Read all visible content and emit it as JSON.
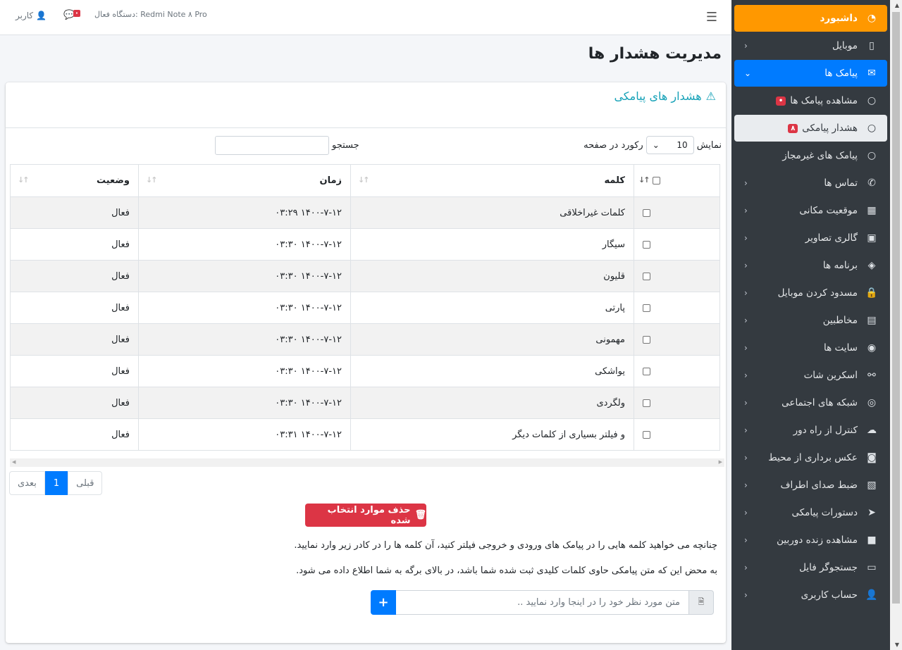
{
  "topbar": {
    "device_text": "دستگاه فعال: Redmi Note ۸ Pro",
    "user_label": "کاربر",
    "chat_badge": "•"
  },
  "page_title": "مدیریت هشدار ها",
  "card": {
    "title": "هشدار های پیامکی"
  },
  "controls": {
    "show_label": "نمایش",
    "length_value": "10",
    "records_label": "رکورد در صفحه",
    "search_label": "جستجو"
  },
  "table": {
    "headers": {
      "word": "کلمه",
      "time": "زمان",
      "status": "وضعیت"
    },
    "rows": [
      {
        "word": "کلمات غیراخلاقی",
        "time": "۱۴۰۰-۷-۱۲ ۰۳:۲۹",
        "status": "فعال"
      },
      {
        "word": "سیگار",
        "time": "۱۴۰۰-۷-۱۲ ۰۳:۳۰",
        "status": "فعال"
      },
      {
        "word": "قلیون",
        "time": "۱۴۰۰-۷-۱۲ ۰۳:۳۰",
        "status": "فعال"
      },
      {
        "word": "پارتی",
        "time": "۱۴۰۰-۷-۱۲ ۰۳:۳۰",
        "status": "فعال"
      },
      {
        "word": "مهمونی",
        "time": "۱۴۰۰-۷-۱۲ ۰۳:۳۰",
        "status": "فعال"
      },
      {
        "word": "یواشکی",
        "time": "۱۴۰۰-۷-۱۲ ۰۳:۳۰",
        "status": "فعال"
      },
      {
        "word": "ولگردی",
        "time": "۱۴۰۰-۷-۱۲ ۰۳:۳۰",
        "status": "فعال"
      },
      {
        "word": "و فیلتر بسیاری از کلمات دیگر",
        "time": "۱۴۰۰-۷-۱۲ ۰۳:۳۱",
        "status": "فعال"
      }
    ]
  },
  "pager": {
    "prev": "قبلی",
    "current": "1",
    "next": "بعدی"
  },
  "delete_button": "حذف موارد انتخاب شده",
  "info": {
    "line1": "چنانچه می خواهید کلمه هایی را در پیامک های ورودی و خروجی فیلتر کنید، آن کلمه ها را در کادر زیر وارد نمایید.",
    "line2": "به محض این که متن پیامکی حاوی کلمات کلیدی ثبت شده شما باشد، در بالای برگه به شما اطلاع داده می شود."
  },
  "add_input": {
    "placeholder": "متن مورد نظر خود را در اینجا وارد نمایید ..",
    "add_label": "+"
  },
  "sidebar": {
    "items": [
      {
        "label": "داشبورد",
        "icon": "dashboard-icon"
      },
      {
        "label": "موبایل",
        "icon": "mobile-icon"
      },
      {
        "label": "پیامک ها",
        "icon": "envelope-icon"
      },
      {
        "label": "مشاهده پیامک ها",
        "icon": "circle-icon",
        "badge": "•"
      },
      {
        "label": "هشدار پیامکی",
        "icon": "circle-icon",
        "badge": "۸"
      },
      {
        "label": "پیامک های غیرمجاز",
        "icon": "circle-icon"
      },
      {
        "label": "تماس ها",
        "icon": "phone-icon"
      },
      {
        "label": "موقعیت مکانی",
        "icon": "map-icon"
      },
      {
        "label": "گالری تصاویر",
        "icon": "image-icon"
      },
      {
        "label": "برنامه ها",
        "icon": "gamepad-icon"
      },
      {
        "label": "مسدود کردن موبایل",
        "icon": "lock-icon"
      },
      {
        "label": "مخاطبین",
        "icon": "book-icon"
      },
      {
        "label": "سایت ها",
        "icon": "chrome-icon"
      },
      {
        "label": "اسکرین شات",
        "icon": "binoculars-icon"
      },
      {
        "label": "شبکه های اجتماعی",
        "icon": "eye-icon"
      },
      {
        "label": "کنترل از راه دور",
        "icon": "cloud-icon"
      },
      {
        "label": "عکس برداری از محیط",
        "icon": "camera-icon"
      },
      {
        "label": "ضبط صدای اطراف",
        "icon": "audio-file-icon"
      },
      {
        "label": "دستورات پیامکی",
        "icon": "paper-plane-icon"
      },
      {
        "label": "مشاهده زنده دوربین",
        "icon": "video-icon"
      },
      {
        "label": "جستجوگر فایل",
        "icon": "folder-icon"
      },
      {
        "label": "حساب کاربری",
        "icon": "user-icon"
      }
    ]
  },
  "colors": {
    "sidebar_bg": "#343a40",
    "dashboard_accent": "#ff9800",
    "primary": "#007bff",
    "danger": "#dc3545",
    "info": "#17a2b8"
  }
}
